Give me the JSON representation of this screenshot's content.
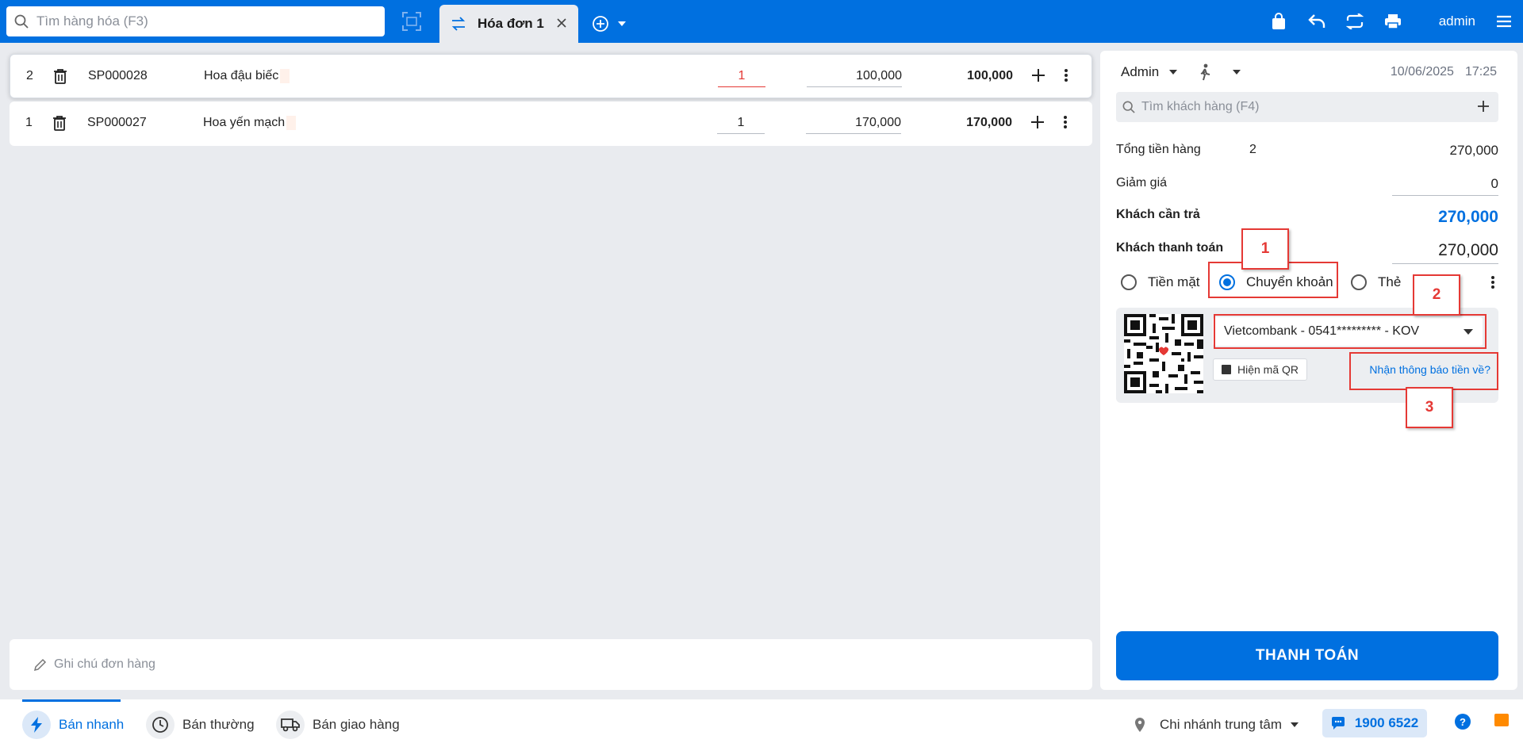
{
  "topbar": {
    "search_placeholder": "Tìm hàng hóa (F3)",
    "tab_label": "Hóa đơn 1",
    "username": "admin"
  },
  "order_rows": [
    {
      "index": "2",
      "code": "SP000028",
      "name": "Hoa đậu biếc",
      "qty": "1",
      "price": "100,000",
      "total": "100,000"
    },
    {
      "index": "1",
      "code": "SP000027",
      "name": "Hoa yến mạch",
      "qty": "1",
      "price": "170,000",
      "total": "170,000"
    }
  ],
  "note_placeholder": "Ghi chú đơn hàng",
  "panel": {
    "staff": "Admin",
    "date": "10/06/2025",
    "time": "17:25",
    "customer_placeholder": "Tìm khách hàng (F4)",
    "subtotal_label": "Tổng tiền hàng",
    "subtotal_count": "2",
    "subtotal_value": "270,000",
    "discount_label": "Giảm giá",
    "discount_value": "0",
    "due_label": "Khách cần trả",
    "due_value": "270,000",
    "paid_label": "Khách thanh toán",
    "paid_value": "270,000",
    "pay_methods": [
      "Tiền mặt",
      "Chuyển khoản",
      "Thẻ"
    ],
    "bank_account": "Vietcombank - 0541********* - KOV",
    "show_qr_label": "Hiện mã QR",
    "notify_link": "Nhận thông báo tiền về?",
    "pay_button": "THANH TOÁN"
  },
  "annotations": [
    "1",
    "2",
    "3"
  ],
  "bottombar": {
    "modes": [
      "Bán nhanh",
      "Bán thường",
      "Bán giao hàng"
    ],
    "branch": "Chi nhánh trung tâm",
    "hotline": "1900 6522",
    "help": "?"
  },
  "colors": {
    "accent": "#0070e0",
    "error": "#e53935",
    "annotation": "#e53935"
  }
}
